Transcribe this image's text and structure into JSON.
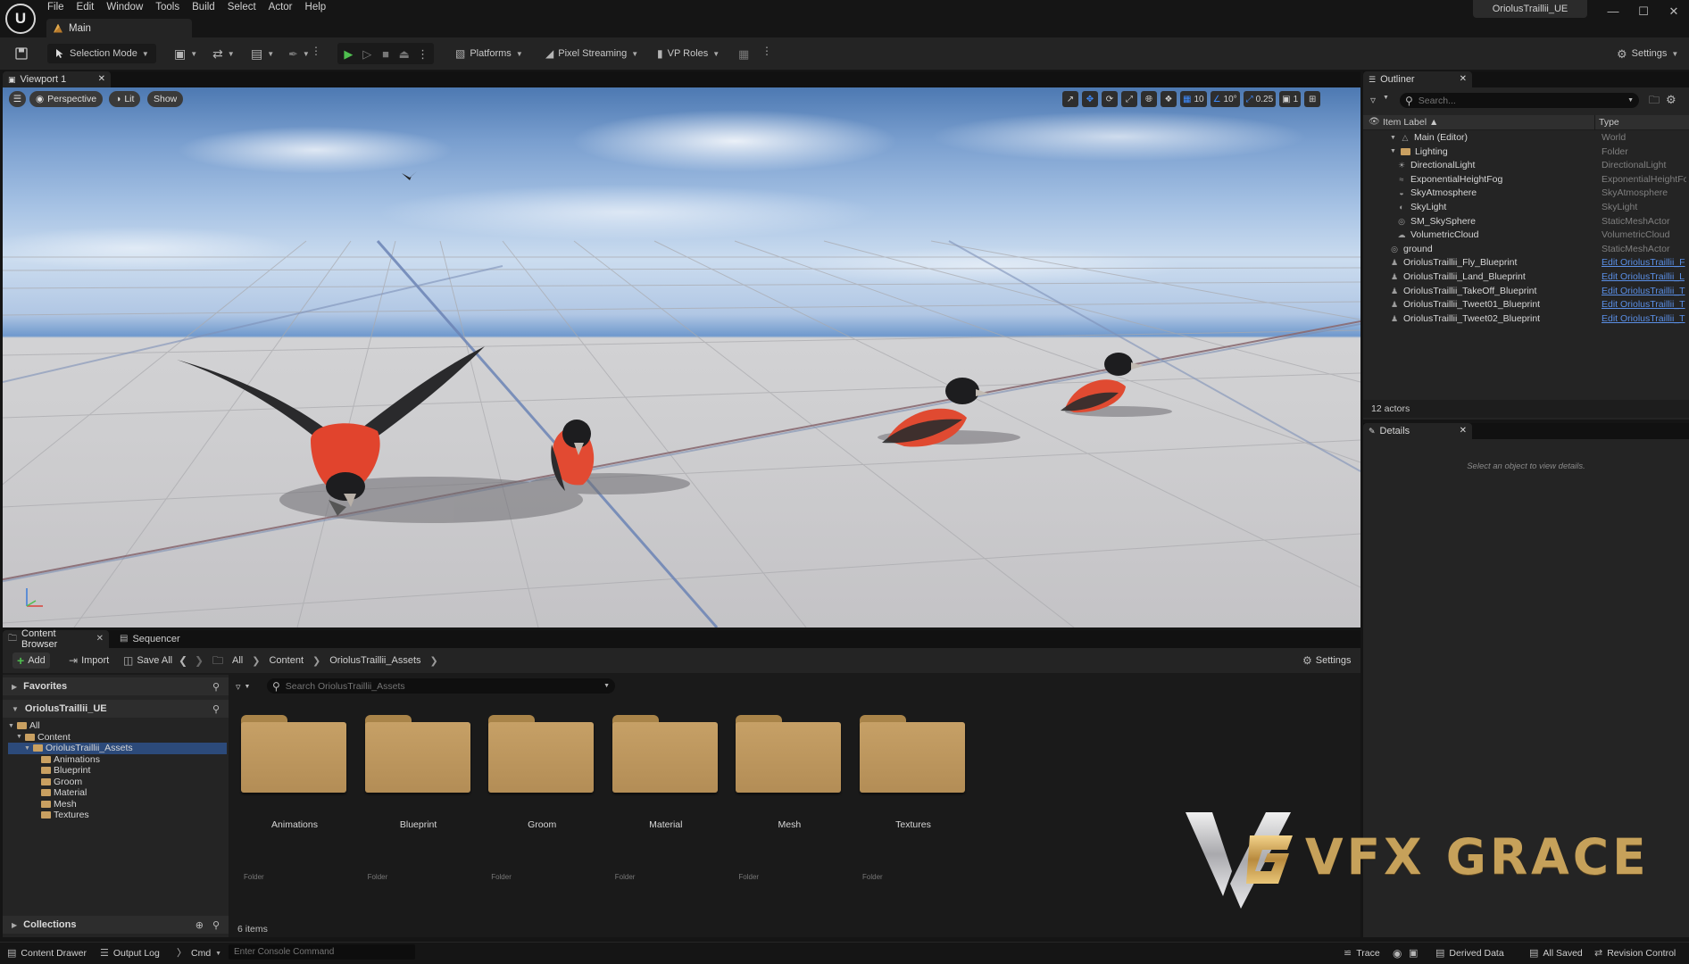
{
  "menubar": [
    "File",
    "Edit",
    "Window",
    "Tools",
    "Build",
    "Select",
    "Actor",
    "Help"
  ],
  "level_tab": "Main",
  "project_title": "OriolusTraillii_UE",
  "toolbar": {
    "selection_mode": "Selection Mode",
    "platforms": "Platforms",
    "pixel_streaming": "Pixel Streaming",
    "vp_roles": "VP Roles",
    "settings": "Settings"
  },
  "viewport": {
    "tab_label": "Viewport 1",
    "perspective": "Perspective",
    "lit": "Lit",
    "show": "Show",
    "grid_snap": "10",
    "rotation_snap": "10°",
    "scale_snap": "0.25",
    "camera_speed": "1"
  },
  "outliner": {
    "tab_label": "Outliner",
    "search_placeholder": "Search...",
    "col_label": "Item Label ▲",
    "col_type": "Type",
    "rows": [
      {
        "label": "Main (Editor)",
        "type": "World",
        "indent": 0,
        "icon": "world-icon"
      },
      {
        "label": "Lighting",
        "type": "Folder",
        "indent": 1,
        "icon": "folder-icon"
      },
      {
        "label": "DirectionalLight",
        "type": "DirectionalLight",
        "indent": 2,
        "icon": "sun-icon"
      },
      {
        "label": "ExponentialHeightFog",
        "type": "ExponentialHeightFog",
        "indent": 2,
        "icon": "fog-icon"
      },
      {
        "label": "SkyAtmosphere",
        "type": "SkyAtmosphere",
        "indent": 2,
        "icon": "atmosphere-icon"
      },
      {
        "label": "SkyLight",
        "type": "SkyLight",
        "indent": 2,
        "icon": "skylight-icon"
      },
      {
        "label": "SM_SkySphere",
        "type": "StaticMeshActor",
        "indent": 2,
        "icon": "mesh-icon"
      },
      {
        "label": "VolumetricCloud",
        "type": "VolumetricCloud",
        "indent": 2,
        "icon": "cloud-icon"
      },
      {
        "label": "ground",
        "type": "StaticMeshActor",
        "indent": 1,
        "icon": "mesh-icon"
      },
      {
        "label": "OriolusTraillii_Fly_Blueprint",
        "type": "Edit OriolusTraillii_F",
        "indent": 1,
        "icon": "pawn-icon",
        "link": true
      },
      {
        "label": "OriolusTraillii_Land_Blueprint",
        "type": "Edit OriolusTraillii_L",
        "indent": 1,
        "icon": "pawn-icon",
        "link": true
      },
      {
        "label": "OriolusTraillii_TakeOff_Blueprint",
        "type": "Edit OriolusTraillii_T",
        "indent": 1,
        "icon": "pawn-icon",
        "link": true
      },
      {
        "label": "OriolusTraillii_Tweet01_Blueprint",
        "type": "Edit OriolusTraillii_T",
        "indent": 1,
        "icon": "pawn-icon",
        "link": true
      },
      {
        "label": "OriolusTraillii_Tweet02_Blueprint",
        "type": "Edit OriolusTraillii_T",
        "indent": 1,
        "icon": "pawn-icon",
        "link": true
      }
    ],
    "actor_count": "12 actors"
  },
  "details": {
    "tab_label": "Details",
    "empty_message": "Select an object to view details."
  },
  "content_browser": {
    "tab_label": "Content Browser",
    "sequencer_tab": "Sequencer",
    "add": "Add",
    "import": "Import",
    "save_all": "Save All",
    "breadcrumb": [
      "All",
      "Content",
      "OriolusTraillii_Assets"
    ],
    "settings": "Settings",
    "favorites": "Favorites",
    "project": "OriolusTraillii_UE",
    "collections": "Collections",
    "tree": [
      {
        "label": "All",
        "level": 0
      },
      {
        "label": "Content",
        "level": 1
      },
      {
        "label": "OriolusTraillii_Assets",
        "level": 2,
        "selected": true
      },
      {
        "label": "Animations",
        "level": 3
      },
      {
        "label": "Blueprint",
        "level": 3
      },
      {
        "label": "Groom",
        "level": 3
      },
      {
        "label": "Material",
        "level": 3
      },
      {
        "label": "Mesh",
        "level": 3
      },
      {
        "label": "Textures",
        "level": 3
      }
    ],
    "search_placeholder": "Search OriolusTraillii_Assets",
    "assets": [
      {
        "name": "Animations",
        "kind": "Folder"
      },
      {
        "name": "Blueprint",
        "kind": "Folder"
      },
      {
        "name": "Groom",
        "kind": "Folder"
      },
      {
        "name": "Material",
        "kind": "Folder"
      },
      {
        "name": "Mesh",
        "kind": "Folder"
      },
      {
        "name": "Textures",
        "kind": "Folder"
      }
    ],
    "items_count": "6 items"
  },
  "watermark_text": "VFX GRACE",
  "statusbar": {
    "content_drawer": "Content Drawer",
    "output_log": "Output Log",
    "cmd": "Cmd",
    "console_placeholder": "Enter Console Command",
    "trace": "Trace",
    "derived_data": "Derived Data",
    "all_saved": "All Saved",
    "revision_control": "Revision Control"
  },
  "colors": {
    "accent_blue": "#3f8cff",
    "play_green": "#4fbf4f",
    "folder_tan": "#c6a066",
    "selection_blue": "#2c4a7a"
  }
}
